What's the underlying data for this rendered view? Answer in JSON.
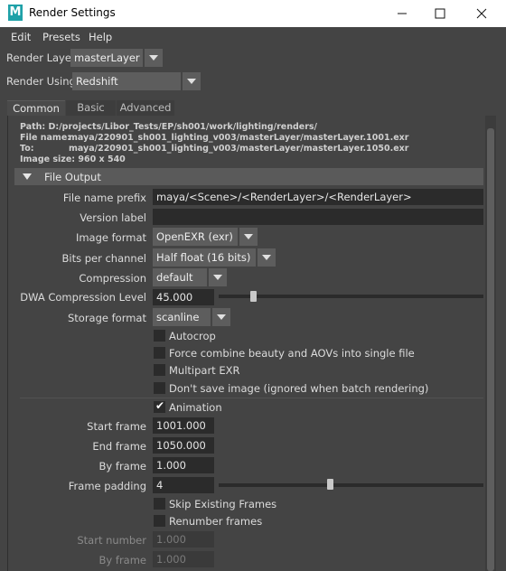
{
  "window": {
    "title": "Render Settings",
    "app_icon_letter": "M"
  },
  "menu": [
    "Edit",
    "Presets",
    "Help"
  ],
  "render_layer": {
    "label": "Render Layer",
    "value": "masterLayer"
  },
  "render_using": {
    "label": "Render Using",
    "value": "Redshift"
  },
  "tabs": [
    "Common",
    "Basic",
    "Advanced"
  ],
  "active_tab": "Common",
  "info": {
    "path": "Path: D:/projects/Libor_Tests/EP/sh001/work/lighting/renders/",
    "file_name_label": "File name:",
    "file_name_value": "maya/220901_sh001_lighting_v003/masterLayer/masterLayer.1001.exr",
    "to_label": "To:",
    "to_value": "maya/220901_sh001_lighting_v003/masterLayer/masterLayer.1050.exr",
    "image_size": "Image size: 960 x 540"
  },
  "section_title": "File Output",
  "fields": {
    "file_name_prefix": {
      "label": "File name prefix",
      "value": "maya/<Scene>/<RenderLayer>/<RenderLayer>"
    },
    "version_label": {
      "label": "Version label",
      "value": ""
    },
    "image_format": {
      "label": "Image format",
      "value": "OpenEXR (exr)"
    },
    "bits_per_channel": {
      "label": "Bits per channel",
      "value": "Half float (16 bits)"
    },
    "compression": {
      "label": "Compression",
      "value": "default"
    },
    "dwa_compression_level": {
      "label": "DWA Compression Level",
      "value": "45.000",
      "slider_fraction": 0.13
    },
    "storage_format": {
      "label": "Storage format",
      "value": "scanline"
    }
  },
  "checkboxes": {
    "autocrop": {
      "label": "Autocrop",
      "checked": false
    },
    "force_combine": {
      "label": "Force combine beauty and AOVs into single file",
      "checked": false
    },
    "multipart_exr": {
      "label": "Multipart EXR",
      "checked": false
    },
    "dont_save": {
      "label": "Don't save image (ignored when batch rendering)",
      "checked": false
    },
    "animation": {
      "label": "Animation",
      "checked": true
    },
    "skip_existing": {
      "label": "Skip Existing Frames",
      "checked": false
    },
    "renumber": {
      "label": "Renumber frames",
      "checked": false
    }
  },
  "frames": {
    "start_frame": {
      "label": "Start frame",
      "value": "1001.000"
    },
    "end_frame": {
      "label": "End frame",
      "value": "1050.000"
    },
    "by_frame": {
      "label": "By frame",
      "value": "1.000"
    },
    "frame_padding": {
      "label": "Frame padding",
      "value": "4",
      "slider_fraction": 0.42
    },
    "start_number": {
      "label": "Start number",
      "value": "1.000"
    },
    "by_frame_renumber": {
      "label": "By frame",
      "value": "1.000"
    }
  }
}
